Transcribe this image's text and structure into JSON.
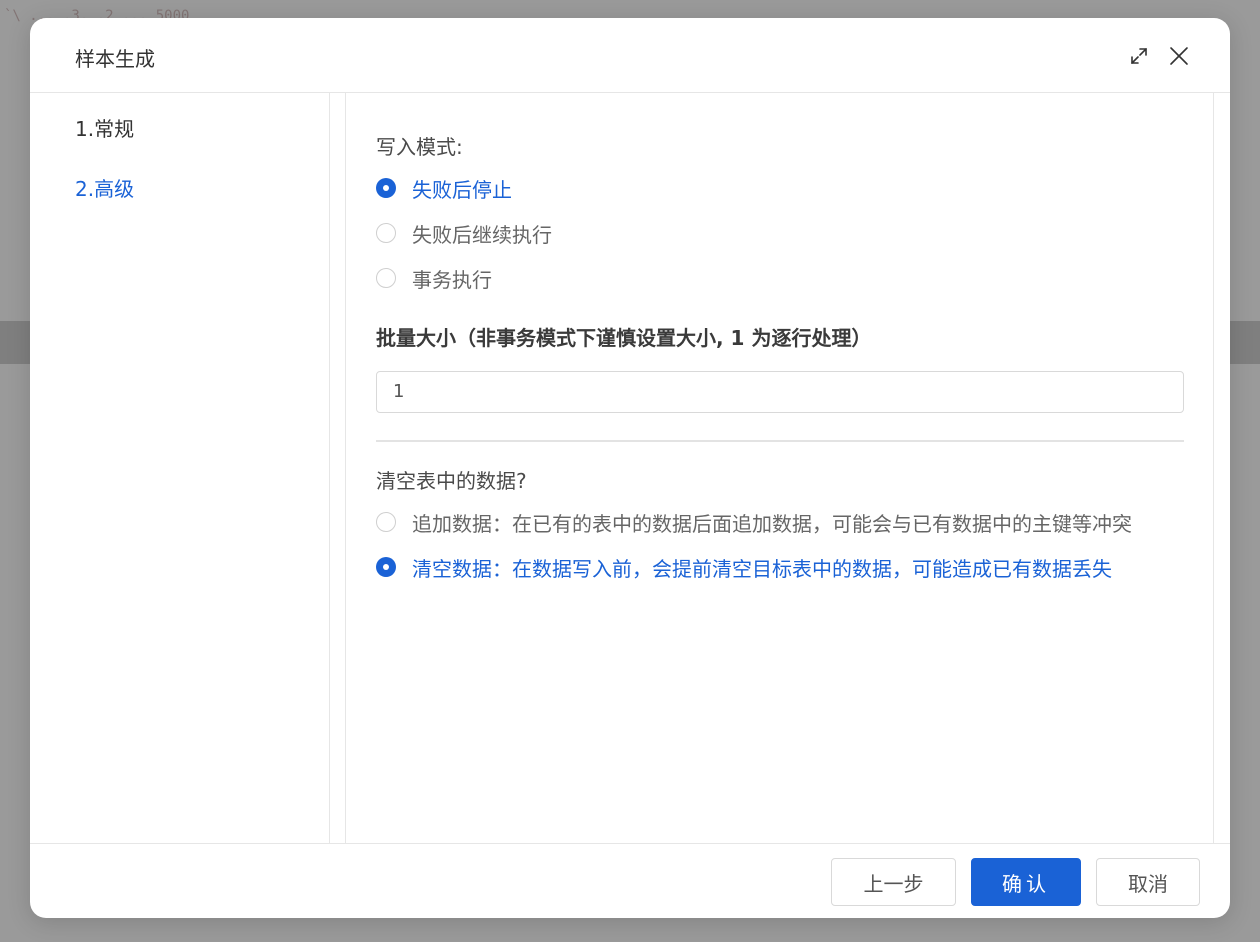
{
  "background": {
    "code_snippet": "`\\ ...  .3.  .2  ... 5000"
  },
  "modal": {
    "title": "样本生成",
    "header_icons": [
      "expand-icon",
      "close-icon"
    ]
  },
  "steps": [
    {
      "label": "1.常规",
      "active": false
    },
    {
      "label": "2.高级",
      "active": true
    }
  ],
  "write_mode": {
    "label": "写入模式:",
    "options": [
      {
        "label": "失败后停止",
        "checked": true
      },
      {
        "label": "失败后继续执行",
        "checked": false
      },
      {
        "label": "事务执行",
        "checked": false
      }
    ]
  },
  "batch_size": {
    "label": "批量大小（非事务模式下谨慎设置大小, 1 为逐行处理）",
    "value": "1"
  },
  "clear_table": {
    "label": "清空表中的数据?",
    "options": [
      {
        "label": "追加数据：在已有的表中的数据后面追加数据，可能会与已有数据中的主键等冲突",
        "checked": false
      },
      {
        "label": "清空数据：在数据写入前，会提前清空目标表中的数据，可能造成已有数据丢失",
        "checked": true
      }
    ]
  },
  "footer": {
    "prev_label": "上一步",
    "confirm_label": "确认",
    "cancel_label": "取消"
  },
  "colors": {
    "accent": "#1a62d6",
    "overlay": "#8f8f8f",
    "text": "#333333"
  }
}
